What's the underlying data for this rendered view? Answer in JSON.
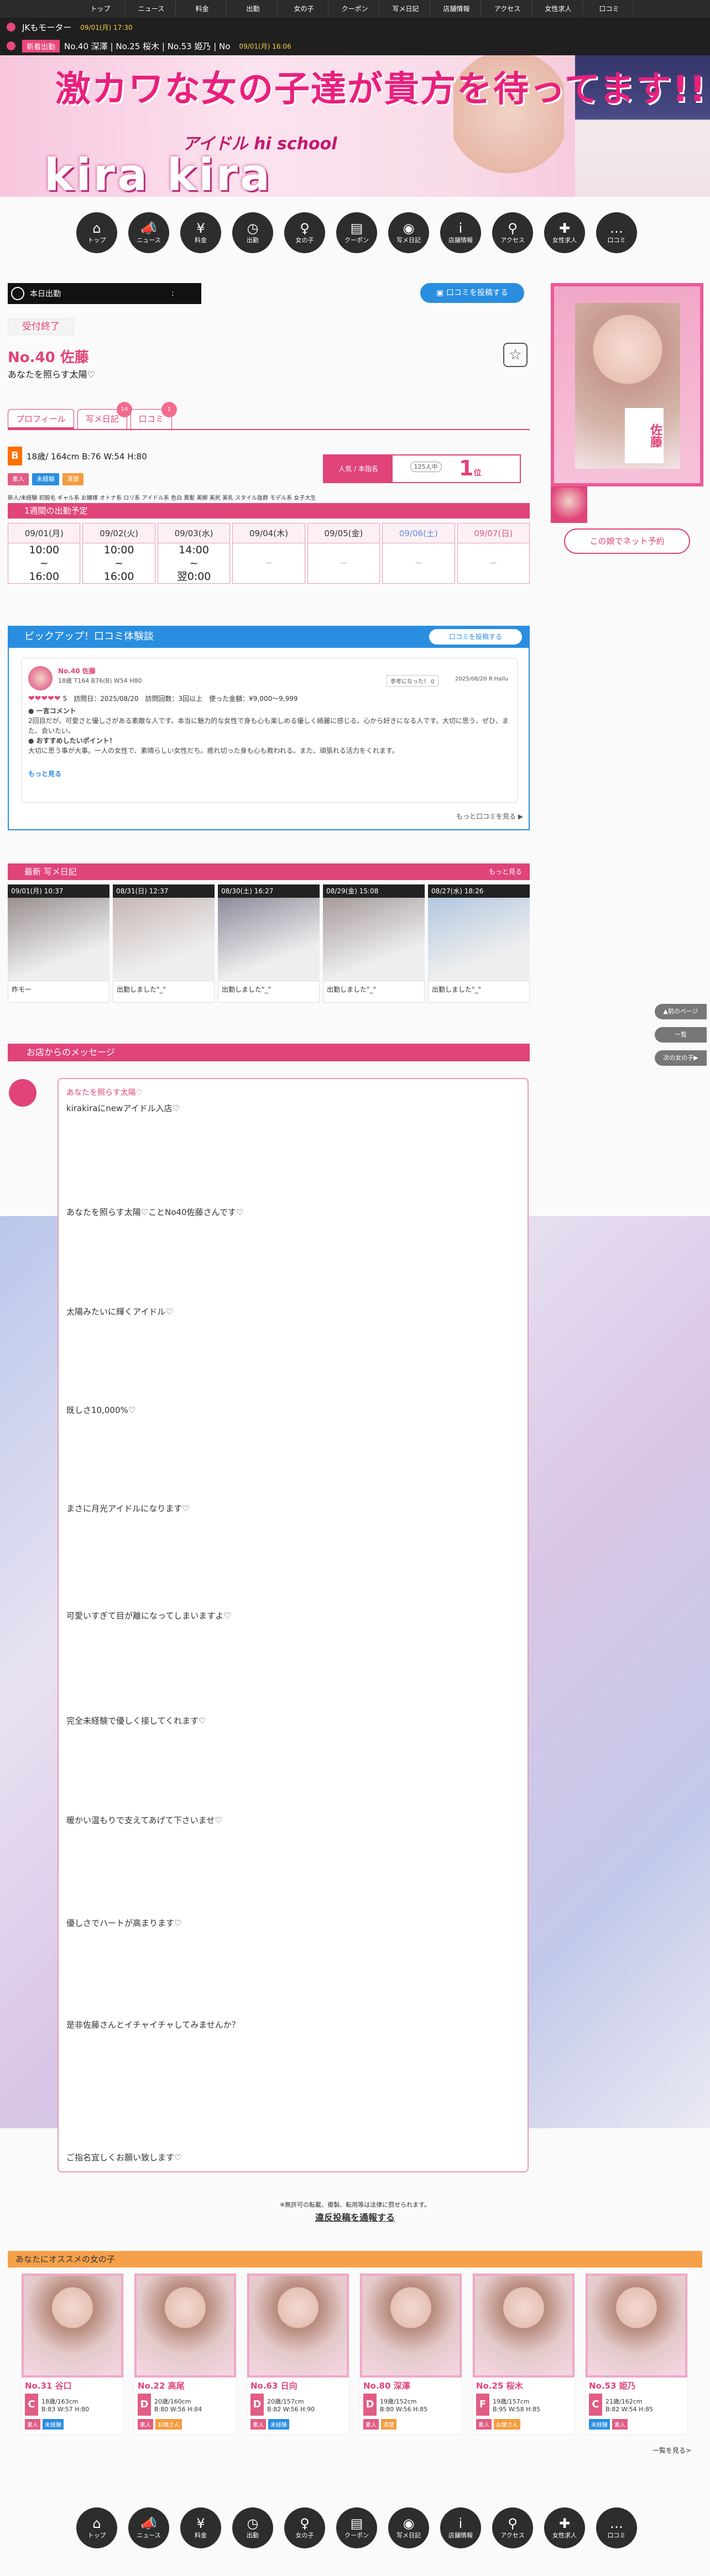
{
  "top_nav": [
    "トップ",
    "ニュース",
    "料金",
    "出勤",
    "女の子",
    "クーポン",
    "写メ日記",
    "店舗情報",
    "アクセス",
    "女性求人",
    "口コミ"
  ],
  "ticker1": {
    "label": "",
    "text": "JKもモーター",
    "time": "09/01(月) 17:30"
  },
  "ticker2": {
    "label": "新着出勤",
    "text": "No.40 深澤 | No.25 桜木 | No.53 姫乃 | No",
    "time": "09/01(月) 16:06"
  },
  "banner": {
    "catch": "激カワな女の子達が貴方を待ってます!!",
    "sub": "アイドル hi school",
    "logo": "kira kira"
  },
  "icon_nav": [
    {
      "label": "トップ",
      "glyph": "⌂"
    },
    {
      "label": "ニュース",
      "glyph": "📣"
    },
    {
      "label": "料金",
      "glyph": "¥"
    },
    {
      "label": "出勤",
      "glyph": "◷"
    },
    {
      "label": "女の子",
      "glyph": "♀"
    },
    {
      "label": "クーポン",
      "glyph": "▤"
    },
    {
      "label": "写メ日記",
      "glyph": "◉"
    },
    {
      "label": "店舗情報",
      "glyph": "i"
    },
    {
      "label": "アクセス",
      "glyph": "⚲"
    },
    {
      "label": "女性求人",
      "glyph": "✚"
    },
    {
      "label": "口コミ",
      "glyph": "…"
    }
  ],
  "status": {
    "text": "本日出勤",
    "time": ":"
  },
  "review_button": "口コミを投稿する",
  "profile": {
    "accepted": "受付終了",
    "name": "No.40 佐藤",
    "catch": "あなたを照らす太陽♡",
    "spec_cup": "B",
    "spec": "18歳/ 164cm B:76 W:54 H:80",
    "tabs": [
      {
        "label": "プロフィール",
        "badge": ""
      },
      {
        "label": "写メ日記",
        "badge": "14"
      },
      {
        "label": "口コミ",
        "badge": "1"
      }
    ],
    "rank_label": "人気 / 本指名",
    "rank_sub": "125人中",
    "rank": "1",
    "rank_unit": "位",
    "tags": [
      {
        "text": "素人",
        "color": "#e05d84"
      },
      {
        "text": "未経験",
        "color": "#2a8ee0"
      },
      {
        "text": "清楚",
        "color": "#f39c3d"
      }
    ],
    "options": "新人/未経験 初脱毛 ギャル系 お嬢様 オトナ系 ロリ系 アイドル系 色白 黒髪 美脚 美尻 美乳 スタイル抜群 モデル系 女子大生",
    "reserve": "この娘でネット予約",
    "side_label": "佐藤"
  },
  "schedule": {
    "title": "1週間の出勤予定",
    "days": [
      {
        "date": "09/01(月)",
        "l1": "10:00",
        "l2": "16:00",
        "cls": ""
      },
      {
        "date": "09/02(火)",
        "l1": "10:00",
        "l2": "16:00",
        "cls": ""
      },
      {
        "date": "09/03(水)",
        "l1": "14:00",
        "l2": "翌0:00",
        "cls": ""
      },
      {
        "date": "09/04(木)",
        "l1": "－",
        "l2": "",
        "cls": "na"
      },
      {
        "date": "09/05(金)",
        "l1": "－",
        "l2": "",
        "cls": "na"
      },
      {
        "date": "09/06(土)",
        "l1": "－",
        "l2": "",
        "cls": "na"
      },
      {
        "date": "09/07(日)",
        "l1": "－",
        "l2": "",
        "cls": "na"
      }
    ]
  },
  "pickup": {
    "title": "ピックアップ！口コミ体験談",
    "btn": "口コミを投稿する",
    "girl": "No.40 佐藤",
    "girl_spec": "18歳 T164 B76(B) W54 H80",
    "chip1": "参考になった！ 0",
    "date": "2025/08/20  R.Hallu",
    "hearts": "❤❤❤❤❤",
    "score": "5",
    "meta": "訪問日：2025/08/20　訪問回数：3回以上　使った金額：¥9,000〜9,999",
    "c1_title": "一言コメント",
    "c1": "2回目だが、可愛さと優しさがある素敵な人です。本当に魅力的な女性で身も心も楽しめる優しく綺麗に感じる。心から好きになる人です。大切に思う、ぜひ、また、会いたい。",
    "c2_title": "おすすめしたいポイント！",
    "c2": "大切に思う事が大事。一人の女性で、素晴らしい女性だち。癒れ切った身も心も救われる。また、頑張れる活力をくれます。",
    "more": "もっと見る",
    "more_all": "もっと口コミを見る ▶"
  },
  "diary": {
    "title": "最新 写メ日記",
    "more": "もっと見る",
    "items": [
      {
        "date": "09/01(月) 10:37",
        "caption": "昨モー"
      },
      {
        "date": "08/31(日) 12:37",
        "caption": "出勤しました\"_\""
      },
      {
        "date": "08/30(土) 16:27",
        "caption": "出勤しました\"_\""
      },
      {
        "date": "08/29(金) 15:08",
        "caption": "出勤しました\"_\""
      },
      {
        "date": "08/27(水) 18:26",
        "caption": "出勤しました\"_\""
      }
    ]
  },
  "side_buttons": [
    "▲前のページ",
    "一覧",
    "次の女の子▶"
  ],
  "message": {
    "title": "お店からのメッセージ",
    "head": "あなたを照らす太陽♡",
    "lines": [
      "kirakiraにnewアイドル入店♡",
      "あなたを照らす太陽♡ことNo40佐藤さんです♡",
      "太陽みたいに輝くアイドル♡",
      "既しさ10,000%♡",
      "まさに月光アイドルになります♡",
      "可愛いすぎて目が離になってしまいますよ♡",
      "完全未経験で優しく接してくれます♡",
      "暖かい温もりで支えてあげて下さいませ♡",
      "優しさでハートが高まります♡",
      "是非佐藤さんとイチャイチャしてみませんか？",
      "ご指名宜しくお願い致します♡"
    ]
  },
  "notice": "※無許可の転載、複製、転用等は法律に罰せられます。",
  "report": "違反投稿を通報する",
  "recommend": {
    "title": "あなたにオススメの女の子",
    "more": "一覧を見る>",
    "girls": [
      {
        "name": "No.31 谷口",
        "cup": "C",
        "cup_color": "#e05d84",
        "spec": "18歳/163cm",
        "bwh": "B:83 W:57 H:80",
        "tags": [
          {
            "t": "素人",
            "c": "#e05d84"
          },
          {
            "t": "未経験",
            "c": "#2a8ee0"
          }
        ]
      },
      {
        "name": "No.22 高尾",
        "cup": "D",
        "cup_color": "#e05d84",
        "spec": "20歳/160cm",
        "bwh": "B:80 W:56 H:84",
        "tags": [
          {
            "t": "素人",
            "c": "#e05d84"
          },
          {
            "t": "お嬢さん",
            "c": "#f39c3d"
          }
        ]
      },
      {
        "name": "No.63 日向",
        "cup": "D",
        "cup_color": "#e05d84",
        "spec": "20歳/157cm",
        "bwh": "B:82 W:56 H:90",
        "tags": [
          {
            "t": "素人",
            "c": "#e05d84"
          },
          {
            "t": "未経験",
            "c": "#2a8ee0"
          }
        ]
      },
      {
        "name": "No.80 深澤",
        "cup": "D",
        "cup_color": "#e05d84",
        "spec": "19歳/152cm",
        "bwh": "B:80 W:56 H:85",
        "tags": [
          {
            "t": "素人",
            "c": "#e05d84"
          },
          {
            "t": "清楚",
            "c": "#f39c3d"
          }
        ]
      },
      {
        "name": "No.25 桜木",
        "cup": "F",
        "cup_color": "#e05d84",
        "spec": "19歳/157cm",
        "bwh": "B:95 W:58 H:85",
        "tags": [
          {
            "t": "素人",
            "c": "#e05d84"
          },
          {
            "t": "お嬢さん",
            "c": "#f39c3d"
          }
        ]
      },
      {
        "name": "No.53 姫乃",
        "cup": "C",
        "cup_color": "#e05d84",
        "spec": "21歳/162cm",
        "bwh": "B:82 W:54 H:85",
        "tags": [
          {
            "t": "未経験",
            "c": "#2a8ee0"
          },
          {
            "t": "素人",
            "c": "#e05d84"
          }
        ]
      }
    ]
  }
}
